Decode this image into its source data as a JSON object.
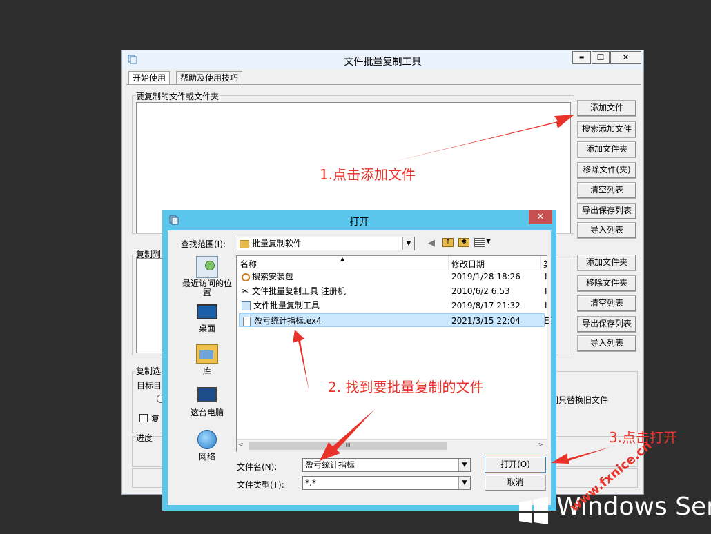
{
  "main_window": {
    "title": "文件批量复制工具",
    "tabs": [
      "开始使用",
      "帮助及使用技巧"
    ],
    "files_group_label": "要复制的文件或文件夹",
    "files_buttons": [
      "添加文件",
      "搜索添加文件",
      "添加文件夹",
      "移除文件(夹)",
      "清空列表",
      "导出保存列表",
      "导入列表"
    ],
    "copy_to_label": "复制到",
    "copy_to_buttons": [
      "添加文件夹",
      "移除文件夹",
      "清空列表",
      "导出保存列表",
      "导入列表"
    ],
    "options_label": "复制选",
    "target_label": "目标目",
    "replace_option": "同只替换旧文件",
    "copy_checkbox_label": "复",
    "progress_label": "进度",
    "minimize": "▬",
    "maximize": "☐",
    "close": "✕"
  },
  "dialog": {
    "title": "打开",
    "close": "✕",
    "lookin_label": "查找范围(I):",
    "lookin_value": "批量复制软件",
    "places": [
      "最近访问的位置",
      "桌面",
      "库",
      "这台电脑",
      "网络"
    ],
    "columns": [
      "名称",
      "修改日期",
      "类"
    ],
    "files": [
      {
        "name": "搜索安装包",
        "date": "2019/1/28 18:26",
        "icon": "search-icon"
      },
      {
        "name": "文件批量复制工具 注册机",
        "date": "2010/6/2 6:53",
        "icon": "scissors-icon"
      },
      {
        "name": "文件批量复制工具",
        "date": "2019/8/17 21:32",
        "icon": "app-icon"
      },
      {
        "name": "盈亏统计指标.ex4",
        "date": "2021/3/15 22:04",
        "icon": "file-icon"
      }
    ],
    "filename_label": "文件名(N):",
    "filename_value": "盈亏统计指标",
    "filetype_label": "文件类型(T):",
    "filetype_value": "*.*",
    "open_button": "打开(O)",
    "cancel_button": "取消",
    "scroll_mark": "III"
  },
  "annotations": {
    "step1": "1.点击添加文件",
    "step2": "2. 找到要批量复制的文件",
    "step3": "3.点击打开",
    "watermark": "www.fxnice.cn"
  },
  "os_brand": "Windows Serve"
}
